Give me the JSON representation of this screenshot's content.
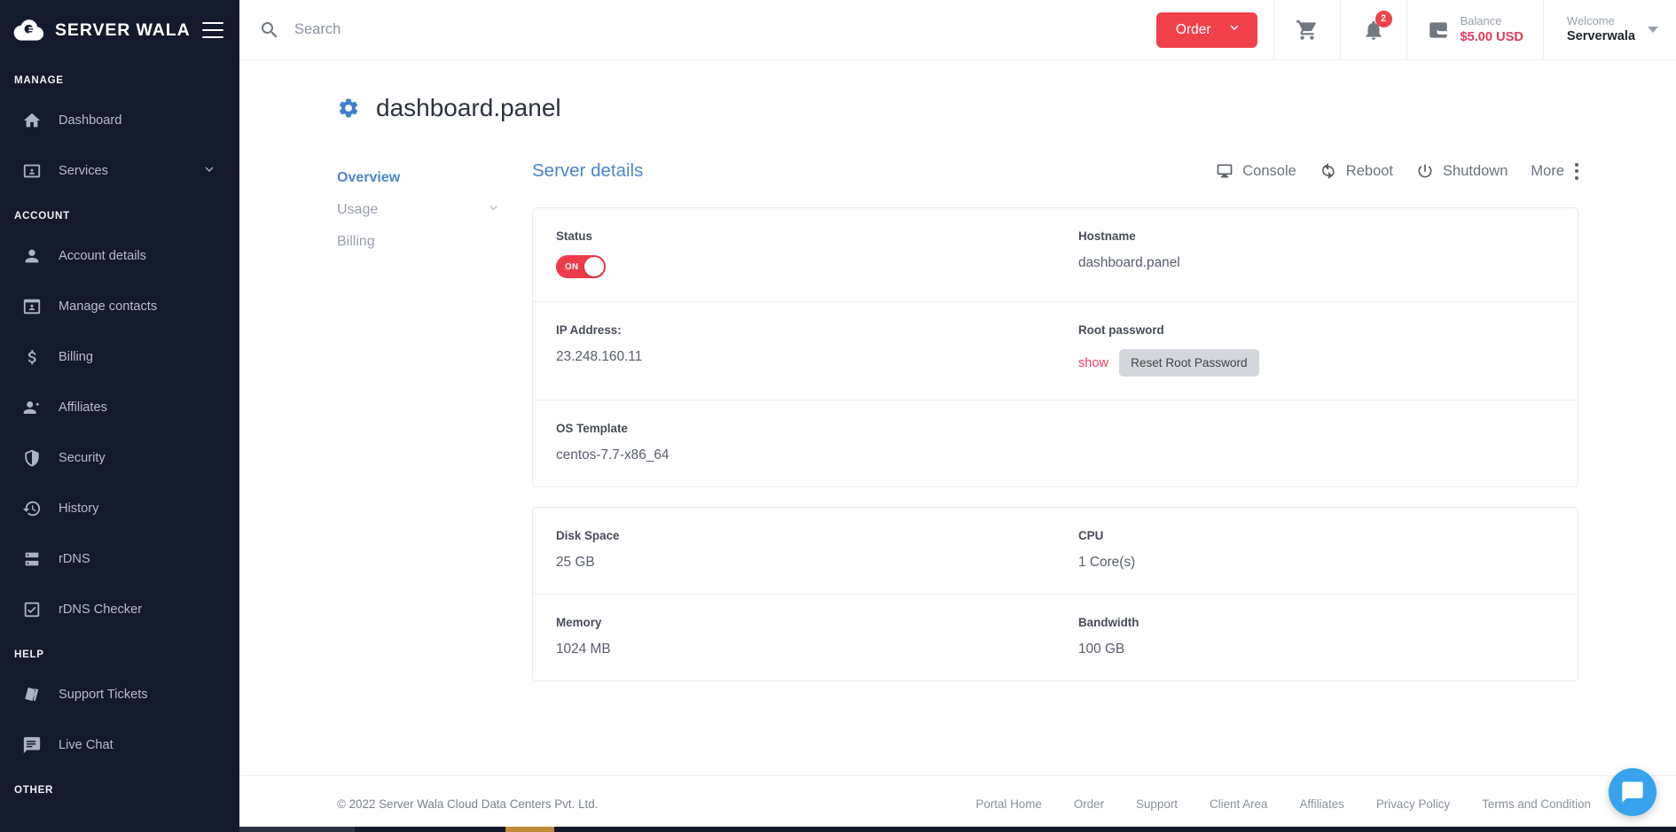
{
  "brand": {
    "name": "SERVER WALA",
    "logo_icon": "cloud-server-logo",
    "menu_icon": "hamburger-menu-icon"
  },
  "sidebar": {
    "sections": [
      {
        "title": "MANAGE",
        "items": [
          {
            "label": "Dashboard",
            "icon": "home-icon",
            "caret": false
          },
          {
            "label": "Services",
            "icon": "services-card-icon",
            "caret": true
          }
        ]
      },
      {
        "title": "ACCOUNT",
        "items": [
          {
            "label": "Account details",
            "icon": "person-icon",
            "caret": false
          },
          {
            "label": "Manage contacts",
            "icon": "contact-card-icon",
            "caret": false
          },
          {
            "label": "Billing",
            "icon": "dollar-icon",
            "caret": false
          },
          {
            "label": "Affiliates",
            "icon": "person-add-icon",
            "caret": false
          },
          {
            "label": "Security",
            "icon": "shield-icon",
            "caret": false
          },
          {
            "label": "History",
            "icon": "history-clock-icon",
            "caret": false
          },
          {
            "label": "rDNS",
            "icon": "server-rack-icon",
            "caret": false
          },
          {
            "label": "rDNS Checker",
            "icon": "checkbox-checked-icon",
            "caret": false
          }
        ]
      },
      {
        "title": "HELP",
        "items": [
          {
            "label": "Support Tickets",
            "icon": "tickets-icon",
            "caret": false
          },
          {
            "label": "Live Chat",
            "icon": "chat-bubble-icon",
            "caret": false
          }
        ]
      },
      {
        "title": "OTHER",
        "items": []
      }
    ]
  },
  "topbar": {
    "search_placeholder": "Search",
    "search_value": "",
    "search_icon": "search-icon",
    "order_label": "Order",
    "order_caret_icon": "chevron-down-icon",
    "cart_icon": "shopping-cart-icon",
    "bell_icon": "bell-icon",
    "notification_count": "2",
    "wallet_icon": "wallet-icon",
    "balance_label": "Balance",
    "balance_value": "$5.00 USD",
    "welcome_label": "Welcome",
    "user_name": "Serverwala",
    "user_caret_icon": "caret-down-icon"
  },
  "page": {
    "gear_icon": "gear-icon",
    "title": "dashboard.panel"
  },
  "tabs": [
    {
      "label": "Overview",
      "active": true,
      "caret": false
    },
    {
      "label": "Usage",
      "active": false,
      "caret": true
    },
    {
      "label": "Billing",
      "active": false,
      "caret": false
    }
  ],
  "detail": {
    "title": "Server details",
    "actions": [
      {
        "label": "Console",
        "icon": "monitor-icon"
      },
      {
        "label": "Reboot",
        "icon": "refresh-icon"
      },
      {
        "label": "Shutdown",
        "icon": "power-icon"
      },
      {
        "label": "More",
        "icon": ""
      }
    ],
    "more_icon": "kebab-menu-icon"
  },
  "fields": {
    "status": {
      "label": "Status",
      "toggle_state": "ON"
    },
    "hostname": {
      "label": "Hostname",
      "value": "dashboard.panel"
    },
    "ip_address": {
      "label": "IP Address:",
      "value": "23.248.160.11"
    },
    "root_password": {
      "label": "Root password",
      "show_label": "show",
      "reset_label": "Reset Root Password"
    },
    "os_template": {
      "label": "OS Template",
      "value": "centos-7.7-x86_64"
    },
    "disk_space": {
      "label": "Disk Space",
      "value": "25 GB"
    },
    "cpu": {
      "label": "CPU",
      "value": "1 Core(s)"
    },
    "memory": {
      "label": "Memory",
      "value": "1024 MB"
    },
    "bandwidth": {
      "label": "Bandwidth",
      "value": "100 GB"
    }
  },
  "footer": {
    "copyright": "© 2022 Server Wala Cloud Data Centers Pvt. Ltd.",
    "links": [
      "Portal Home",
      "Order",
      "Support",
      "Client Area",
      "Affiliates",
      "Privacy Policy",
      "Terms and Condition"
    ],
    "chat_icon": "chat-launcher-icon"
  },
  "colors": {
    "sidebar_bg": "#131a2b",
    "accent_red": "#f0414b",
    "link_blue": "#4a87cc",
    "balance_red": "#e03a5a",
    "chat_blue": "#38a3ec"
  }
}
